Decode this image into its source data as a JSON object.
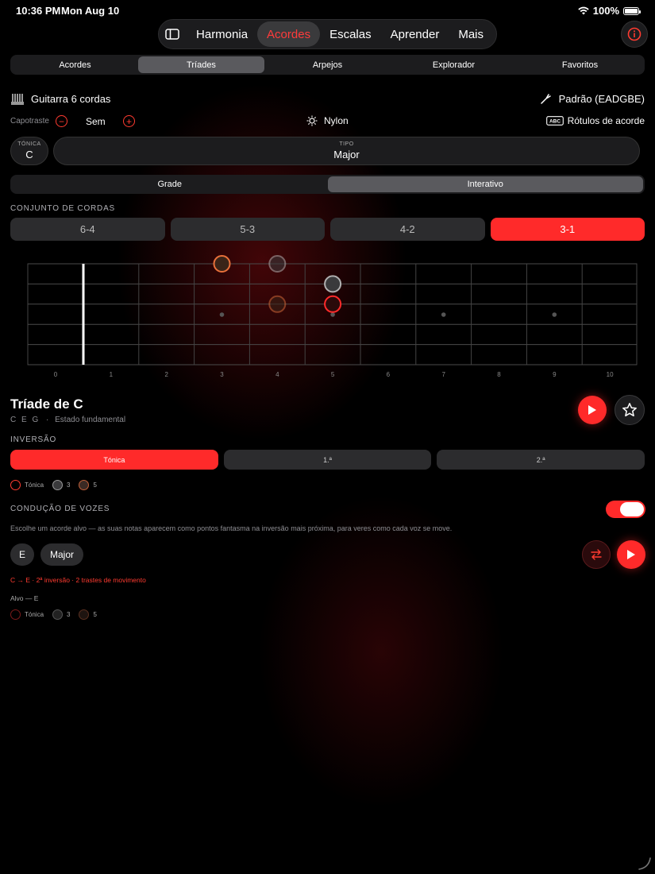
{
  "status": {
    "time": "10:36 PM",
    "date": "Mon Aug 10",
    "battery": "100%"
  },
  "nav": {
    "items": [
      {
        "label": "Harmonia",
        "active": false
      },
      {
        "label": "Acordes",
        "active": true
      },
      {
        "label": "Escalas",
        "active": false
      },
      {
        "label": "Aprender",
        "active": false
      },
      {
        "label": "Mais",
        "active": false
      }
    ]
  },
  "subtabs": [
    "Acordes",
    "Tríades",
    "Arpejos",
    "Explorador",
    "Favoritos"
  ],
  "subtabs_active": "Tríades",
  "instrument": {
    "name": "Guitarra 6 cordas",
    "tuning": "Padrão (EADGBE)"
  },
  "capo": {
    "label": "Capotraste",
    "value": "Sem"
  },
  "string_type": "Nylon",
  "chord_labels": "Rótulos de acorde",
  "tonic": {
    "label": "TÓNICA",
    "value": "C"
  },
  "tipo": {
    "label": "TIPO",
    "value": "Major"
  },
  "view_tabs": [
    "Grade",
    "Interativo"
  ],
  "view_active": "Interativo",
  "string_set": {
    "title": "CONJUNTO DE CORDAS",
    "options": [
      "6-4",
      "5-3",
      "4-2",
      "3-1"
    ],
    "active": "3-1"
  },
  "fretboard": {
    "fret_numbers": [
      "0",
      "1",
      "2",
      "3",
      "4",
      "5",
      "6",
      "7",
      "8",
      "9",
      "10"
    ],
    "inlays": [
      3,
      5,
      7,
      9
    ],
    "notes": [
      {
        "string": 1,
        "fret": 3,
        "role": "root",
        "ghost": false
      },
      {
        "string": 1,
        "fret": 4,
        "role": "third",
        "ghost": true
      },
      {
        "string": 2,
        "fret": 5,
        "role": "third",
        "ghost": false
      },
      {
        "string": 3,
        "fret": 4,
        "role": "fifth",
        "ghost": true
      },
      {
        "string": 3,
        "fret": 5,
        "role": "root",
        "ghost": false
      }
    ]
  },
  "chord": {
    "title": "Tríade de C",
    "notes": "C E G",
    "state": "Estado fundamental"
  },
  "inversion": {
    "title": "INVERSÃO",
    "options": [
      "Tónica",
      "1.ª",
      "2.ª"
    ],
    "active": "Tónica"
  },
  "legend": [
    {
      "label": "Tónica",
      "color": "#ff3b30"
    },
    {
      "label": "3",
      "color": "#9a9a9a"
    },
    {
      "label": "5",
      "color": "#c0603a"
    }
  ],
  "voice_leading": {
    "title": "CONDUÇÃO DE VOZES",
    "enabled": true,
    "description": "Escolhe um acorde alvo — as suas notas aparecem como pontos fantasma na inversão mais próxima, para veres como cada voz se move.",
    "target_note": "E",
    "target_type": "Major",
    "result": "C → E · 2ª inversão · 2 trastes de movimento",
    "target_label": "Alvo — E"
  },
  "target_legend": [
    {
      "label": "Tónica",
      "color": "#7a1a1a"
    },
    {
      "label": "3",
      "color": "#555555"
    },
    {
      "label": "5",
      "color": "#5a3020"
    }
  ],
  "colors": {
    "accent": "#ff2a2a",
    "bg": "#000000",
    "panel": "#1c1c1e"
  }
}
